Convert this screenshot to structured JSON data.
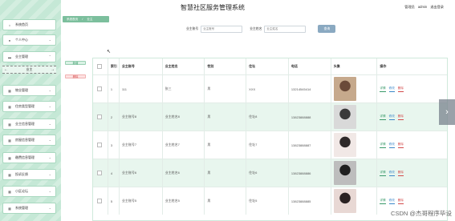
{
  "header": {
    "title": "智慧社区服务管理系统",
    "role": "管理员",
    "username": "admin",
    "logout": "退出登录"
  },
  "breadcrumb": {
    "home": "系统首页",
    "current": "业主"
  },
  "sidebar": {
    "items": [
      {
        "label": "系统首页",
        "icon": "home-icon"
      },
      {
        "label": "个人中心",
        "icon": "person-icon"
      },
      {
        "label": "业主管理",
        "icon": "folder-icon"
      },
      {
        "label": "物业管理",
        "icon": "grid-icon"
      },
      {
        "label": "住房类型管理",
        "icon": "grid-icon"
      },
      {
        "label": "业主信息管理",
        "icon": "grid-icon"
      },
      {
        "label": "房屋信息管理",
        "icon": "grid-icon"
      },
      {
        "label": "缴费信息管理",
        "icon": "grid-icon"
      },
      {
        "label": "投诉反馈",
        "icon": "grid-icon"
      },
      {
        "label": "小区论坛",
        "icon": "grid-icon"
      },
      {
        "label": "系统管理",
        "icon": "grid-icon"
      }
    ],
    "sub_item": "业主"
  },
  "search": {
    "owner_no_label": "业主账号",
    "owner_no_placeholder": "业主账号",
    "owner_name_label": "业主姓名",
    "owner_name_placeholder": "业主姓名",
    "button": "查询"
  },
  "actions": {
    "add": "新增",
    "delete": "删除"
  },
  "table": {
    "columns": [
      "",
      "索引",
      "业主账号",
      "业主姓名",
      "性别",
      "住址",
      "电话",
      "头像",
      "操作"
    ],
    "ops": {
      "detail": "详情",
      "edit": "修改",
      "delete": "删除"
    },
    "rows": [
      {
        "index": "1",
        "account": "111",
        "name": "张三",
        "gender": "男",
        "address": "XXX",
        "phone": "13214545414",
        "photo_colors": [
          "#c6a98c",
          "#6b4a39"
        ]
      },
      {
        "index": "2",
        "account": "业主账号8",
        "name": "业主姓名8",
        "gender": "男",
        "address": "住址8",
        "phone": "13823888888",
        "photo_colors": [
          "#d9d9d9",
          "#3a3a3a"
        ]
      },
      {
        "index": "3",
        "account": "业主账号7",
        "name": "业主姓名7",
        "gender": "男",
        "address": "住址7",
        "phone": "13823888887",
        "photo_colors": [
          "#f1e8e6",
          "#2f2a2a"
        ]
      },
      {
        "index": "4",
        "account": "业主账号6",
        "name": "业主姓名6",
        "gender": "男",
        "address": "住址6",
        "phone": "13823888886",
        "photo_colors": [
          "#bdbdbd",
          "#1f1f1f"
        ]
      },
      {
        "index": "5",
        "account": "业主账号5",
        "name": "业主姓名5",
        "gender": "男",
        "address": "住址5",
        "phone": "13823888885",
        "photo_colors": [
          "#e8d8d4",
          "#2a2222"
        ]
      }
    ]
  },
  "watermark": "CSDN @杰哥程序毕设"
}
